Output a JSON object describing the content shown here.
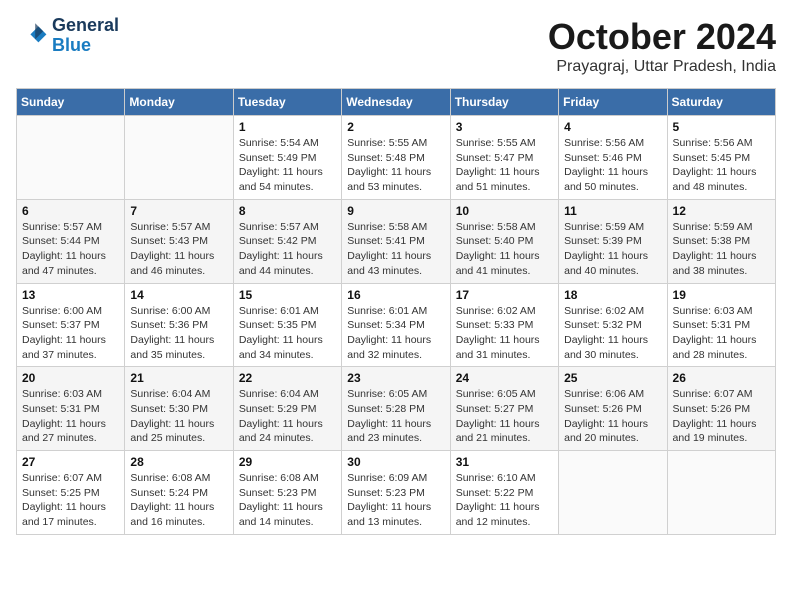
{
  "header": {
    "logo_line1": "General",
    "logo_line2": "Blue",
    "month_title": "October 2024",
    "location": "Prayagraj, Uttar Pradesh, India"
  },
  "weekdays": [
    "Sunday",
    "Monday",
    "Tuesday",
    "Wednesday",
    "Thursday",
    "Friday",
    "Saturday"
  ],
  "weeks": [
    [
      {
        "day": "",
        "sunrise": "",
        "sunset": "",
        "daylight": ""
      },
      {
        "day": "",
        "sunrise": "",
        "sunset": "",
        "daylight": ""
      },
      {
        "day": "1",
        "sunrise": "Sunrise: 5:54 AM",
        "sunset": "Sunset: 5:49 PM",
        "daylight": "Daylight: 11 hours and 54 minutes."
      },
      {
        "day": "2",
        "sunrise": "Sunrise: 5:55 AM",
        "sunset": "Sunset: 5:48 PM",
        "daylight": "Daylight: 11 hours and 53 minutes."
      },
      {
        "day": "3",
        "sunrise": "Sunrise: 5:55 AM",
        "sunset": "Sunset: 5:47 PM",
        "daylight": "Daylight: 11 hours and 51 minutes."
      },
      {
        "day": "4",
        "sunrise": "Sunrise: 5:56 AM",
        "sunset": "Sunset: 5:46 PM",
        "daylight": "Daylight: 11 hours and 50 minutes."
      },
      {
        "day": "5",
        "sunrise": "Sunrise: 5:56 AM",
        "sunset": "Sunset: 5:45 PM",
        "daylight": "Daylight: 11 hours and 48 minutes."
      }
    ],
    [
      {
        "day": "6",
        "sunrise": "Sunrise: 5:57 AM",
        "sunset": "Sunset: 5:44 PM",
        "daylight": "Daylight: 11 hours and 47 minutes."
      },
      {
        "day": "7",
        "sunrise": "Sunrise: 5:57 AM",
        "sunset": "Sunset: 5:43 PM",
        "daylight": "Daylight: 11 hours and 46 minutes."
      },
      {
        "day": "8",
        "sunrise": "Sunrise: 5:57 AM",
        "sunset": "Sunset: 5:42 PM",
        "daylight": "Daylight: 11 hours and 44 minutes."
      },
      {
        "day": "9",
        "sunrise": "Sunrise: 5:58 AM",
        "sunset": "Sunset: 5:41 PM",
        "daylight": "Daylight: 11 hours and 43 minutes."
      },
      {
        "day": "10",
        "sunrise": "Sunrise: 5:58 AM",
        "sunset": "Sunset: 5:40 PM",
        "daylight": "Daylight: 11 hours and 41 minutes."
      },
      {
        "day": "11",
        "sunrise": "Sunrise: 5:59 AM",
        "sunset": "Sunset: 5:39 PM",
        "daylight": "Daylight: 11 hours and 40 minutes."
      },
      {
        "day": "12",
        "sunrise": "Sunrise: 5:59 AM",
        "sunset": "Sunset: 5:38 PM",
        "daylight": "Daylight: 11 hours and 38 minutes."
      }
    ],
    [
      {
        "day": "13",
        "sunrise": "Sunrise: 6:00 AM",
        "sunset": "Sunset: 5:37 PM",
        "daylight": "Daylight: 11 hours and 37 minutes."
      },
      {
        "day": "14",
        "sunrise": "Sunrise: 6:00 AM",
        "sunset": "Sunset: 5:36 PM",
        "daylight": "Daylight: 11 hours and 35 minutes."
      },
      {
        "day": "15",
        "sunrise": "Sunrise: 6:01 AM",
        "sunset": "Sunset: 5:35 PM",
        "daylight": "Daylight: 11 hours and 34 minutes."
      },
      {
        "day": "16",
        "sunrise": "Sunrise: 6:01 AM",
        "sunset": "Sunset: 5:34 PM",
        "daylight": "Daylight: 11 hours and 32 minutes."
      },
      {
        "day": "17",
        "sunrise": "Sunrise: 6:02 AM",
        "sunset": "Sunset: 5:33 PM",
        "daylight": "Daylight: 11 hours and 31 minutes."
      },
      {
        "day": "18",
        "sunrise": "Sunrise: 6:02 AM",
        "sunset": "Sunset: 5:32 PM",
        "daylight": "Daylight: 11 hours and 30 minutes."
      },
      {
        "day": "19",
        "sunrise": "Sunrise: 6:03 AM",
        "sunset": "Sunset: 5:31 PM",
        "daylight": "Daylight: 11 hours and 28 minutes."
      }
    ],
    [
      {
        "day": "20",
        "sunrise": "Sunrise: 6:03 AM",
        "sunset": "Sunset: 5:31 PM",
        "daylight": "Daylight: 11 hours and 27 minutes."
      },
      {
        "day": "21",
        "sunrise": "Sunrise: 6:04 AM",
        "sunset": "Sunset: 5:30 PM",
        "daylight": "Daylight: 11 hours and 25 minutes."
      },
      {
        "day": "22",
        "sunrise": "Sunrise: 6:04 AM",
        "sunset": "Sunset: 5:29 PM",
        "daylight": "Daylight: 11 hours and 24 minutes."
      },
      {
        "day": "23",
        "sunrise": "Sunrise: 6:05 AM",
        "sunset": "Sunset: 5:28 PM",
        "daylight": "Daylight: 11 hours and 23 minutes."
      },
      {
        "day": "24",
        "sunrise": "Sunrise: 6:05 AM",
        "sunset": "Sunset: 5:27 PM",
        "daylight": "Daylight: 11 hours and 21 minutes."
      },
      {
        "day": "25",
        "sunrise": "Sunrise: 6:06 AM",
        "sunset": "Sunset: 5:26 PM",
        "daylight": "Daylight: 11 hours and 20 minutes."
      },
      {
        "day": "26",
        "sunrise": "Sunrise: 6:07 AM",
        "sunset": "Sunset: 5:26 PM",
        "daylight": "Daylight: 11 hours and 19 minutes."
      }
    ],
    [
      {
        "day": "27",
        "sunrise": "Sunrise: 6:07 AM",
        "sunset": "Sunset: 5:25 PM",
        "daylight": "Daylight: 11 hours and 17 minutes."
      },
      {
        "day": "28",
        "sunrise": "Sunrise: 6:08 AM",
        "sunset": "Sunset: 5:24 PM",
        "daylight": "Daylight: 11 hours and 16 minutes."
      },
      {
        "day": "29",
        "sunrise": "Sunrise: 6:08 AM",
        "sunset": "Sunset: 5:23 PM",
        "daylight": "Daylight: 11 hours and 14 minutes."
      },
      {
        "day": "30",
        "sunrise": "Sunrise: 6:09 AM",
        "sunset": "Sunset: 5:23 PM",
        "daylight": "Daylight: 11 hours and 13 minutes."
      },
      {
        "day": "31",
        "sunrise": "Sunrise: 6:10 AM",
        "sunset": "Sunset: 5:22 PM",
        "daylight": "Daylight: 11 hours and 12 minutes."
      },
      {
        "day": "",
        "sunrise": "",
        "sunset": "",
        "daylight": ""
      },
      {
        "day": "",
        "sunrise": "",
        "sunset": "",
        "daylight": ""
      }
    ]
  ]
}
